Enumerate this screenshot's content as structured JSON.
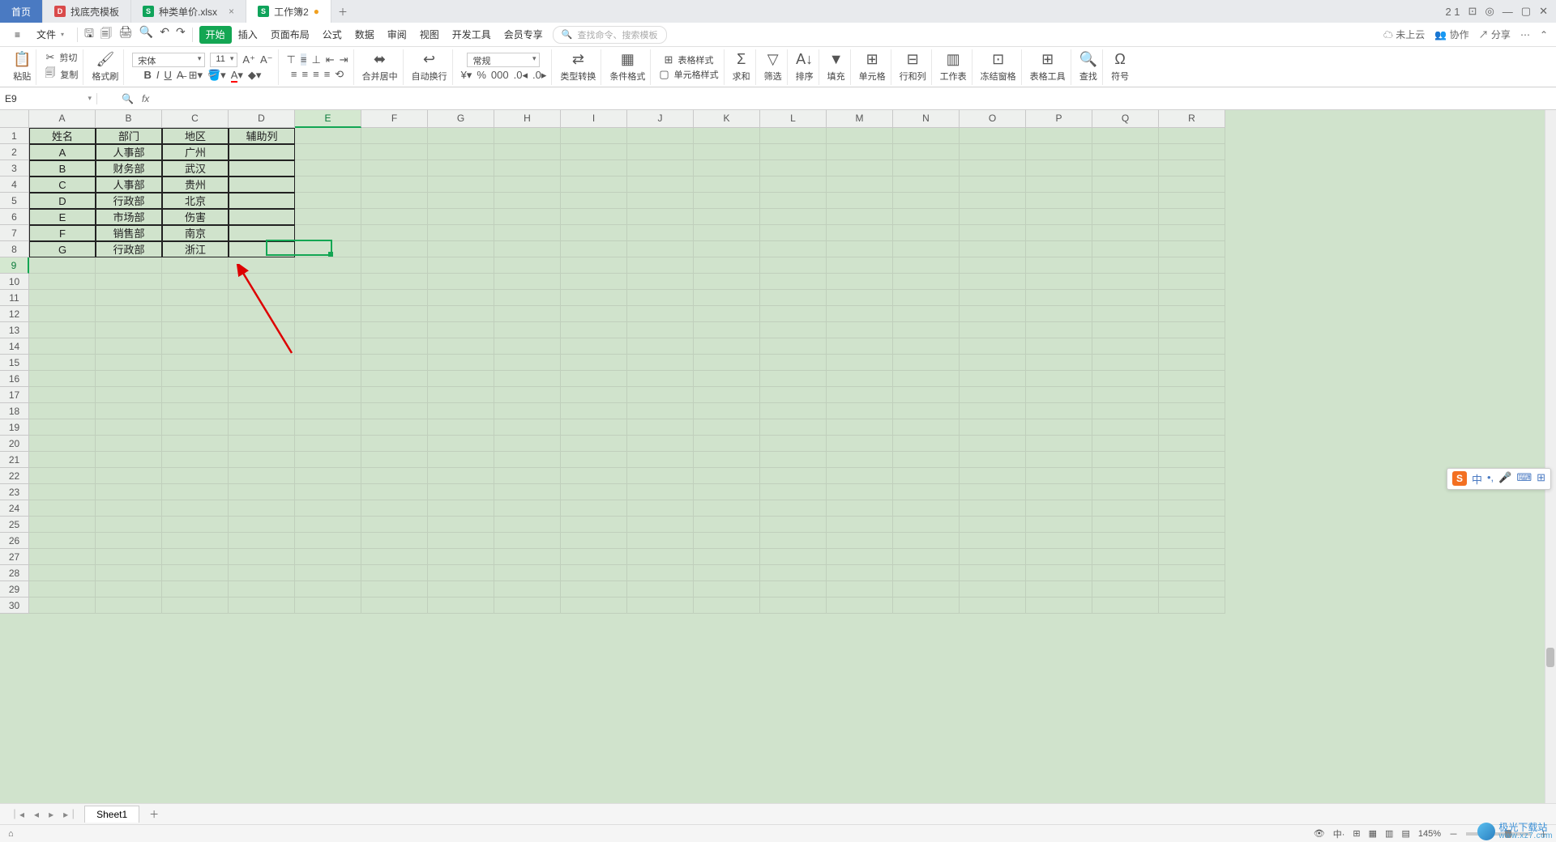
{
  "tabs": {
    "home": "首页",
    "t1": "找底壳模板",
    "t2": "种类单价.xlsx",
    "t3": "工作簿2",
    "close": "×",
    "dirty": "●",
    "add": "＋"
  },
  "winctrl": {
    "grid": "⊞",
    "apps": "⊡",
    "user": "◎",
    "min": "—",
    "max": "▢",
    "close": "✕",
    "num": "2 1"
  },
  "menu": {
    "hamburger": "≡",
    "file": "文件",
    "items": [
      "开始",
      "插入",
      "页面布局",
      "公式",
      "数据",
      "审阅",
      "视图",
      "开发工具",
      "会员专享"
    ],
    "active_index": 0,
    "search_ph": "查找命令、搜索模板",
    "cloud": "未上云",
    "coop": "协作",
    "share": "分享"
  },
  "ribbon": {
    "paste": "粘贴",
    "cut": "剪切",
    "copy": "复制",
    "format_painter": "格式刷",
    "font_name": "宋体",
    "font_size": "11",
    "merge": "合并居中",
    "wrap": "自动换行",
    "number_format": "常规",
    "type_conv": "类型转换",
    "cond_fmt": "条件格式",
    "table_style": "表格样式",
    "cell_style": "单元格样式",
    "sum": "求和",
    "filter": "筛选",
    "sort": "排序",
    "fill": "填充",
    "cells": "单元格",
    "rowscols": "行和列",
    "worksheet": "工作表",
    "freeze": "冻结窗格",
    "tabletools": "表格工具",
    "find": "查找",
    "symbols": "符号"
  },
  "fbar": {
    "cell": "E9",
    "fx": "fx"
  },
  "cols": [
    "A",
    "B",
    "C",
    "D",
    "E",
    "F",
    "G",
    "H",
    "I",
    "J",
    "K",
    "L",
    "M",
    "N",
    "O",
    "P",
    "Q",
    "R"
  ],
  "sel_col": 4,
  "rows": 30,
  "sel_row": 8,
  "table": {
    "header": [
      "姓名",
      "部门",
      "地区",
      "辅助列"
    ],
    "rows": [
      [
        "A",
        "人事部",
        "广州",
        ""
      ],
      [
        "B",
        "财务部",
        "武汉",
        ""
      ],
      [
        "C",
        "人事部",
        "贵州",
        ""
      ],
      [
        "D",
        "行政部",
        "北京",
        ""
      ],
      [
        "E",
        "市场部",
        "伤害",
        ""
      ],
      [
        "F",
        "销售部",
        "南京",
        ""
      ],
      [
        "G",
        "行政部",
        "浙江",
        ""
      ]
    ]
  },
  "sheet": {
    "name": "Sheet1",
    "add": "＋"
  },
  "status": {
    "zoom": "145%",
    "views": [
      "⊞",
      "▦",
      "▥",
      "▤"
    ],
    "ready": "⌂"
  },
  "ime": {
    "s": "S",
    "zh": "中",
    "punct": "•,",
    "mic": "🎤",
    "kb": "⌨",
    "grid": "⊞"
  },
  "watermark": {
    "name": "极光下载站",
    "url": "www.xz7.com"
  }
}
